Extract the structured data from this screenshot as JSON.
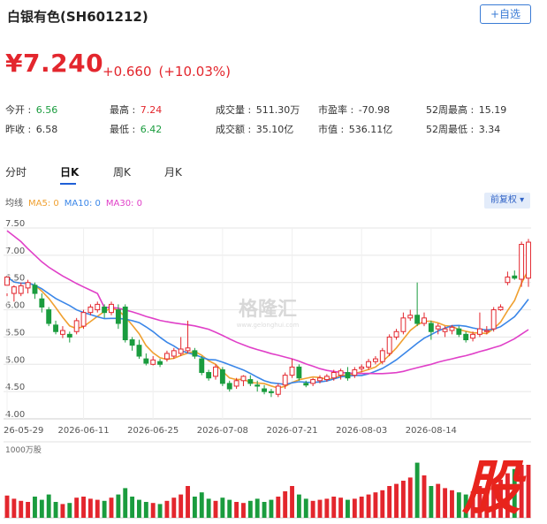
{
  "header": {
    "title": "白银有色(SH601212)",
    "favorite_label": "+自选"
  },
  "quote": {
    "price": "¥7.240",
    "change": "+0.660",
    "change_pct": "(+10.03%)"
  },
  "stats": [
    {
      "label": "今开",
      "value": "6.56",
      "color": "green"
    },
    {
      "label": "最高",
      "value": "7.24",
      "color": "red"
    },
    {
      "label": "成交量",
      "value": "511.30万",
      "color": "dark"
    },
    {
      "label": "市盈率",
      "value": "-70.98",
      "color": "dark"
    },
    {
      "label": "52周最高",
      "value": "15.19",
      "color": "dark"
    },
    {
      "label": "昨收",
      "value": "6.58",
      "color": "dark"
    },
    {
      "label": "最低",
      "value": "6.42",
      "color": "green"
    },
    {
      "label": "成交额",
      "value": "35.10亿",
      "color": "dark"
    },
    {
      "label": "市值",
      "value": "536.11亿",
      "color": "dark"
    },
    {
      "label": "52周最低",
      "value": "3.34",
      "color": "dark"
    }
  ],
  "tabs": [
    {
      "label": "分时",
      "active": false
    },
    {
      "label": "日K",
      "active": true
    },
    {
      "label": "周K",
      "active": false
    },
    {
      "label": "月K",
      "active": false
    }
  ],
  "ma_legend": {
    "prefix": "均线",
    "items": [
      {
        "label": "MA5: 0",
        "color": "#f0a030"
      },
      {
        "label": "MA10: 0",
        "color": "#3a86e8"
      },
      {
        "label": "MA30: 0",
        "color": "#e040c8"
      }
    ]
  },
  "adjust_label": "前复权",
  "volume_label": "1000万股",
  "watermark": "格隆汇",
  "watermark_sub": "www.gelonghui.com",
  "chart_data": {
    "type": "candlestick",
    "y_ticks": [
      "7.50",
      "7.00",
      "6.50",
      "6.00",
      "5.50",
      "5.00",
      "4.50",
      "4.00"
    ],
    "ylim": [
      4.0,
      7.5
    ],
    "x_tick_labels": [
      "26-05-29",
      "2026-06-11",
      "2026-06-25",
      "2026-07-08",
      "2026-07-21",
      "2026-08-03",
      "2026-08-14"
    ],
    "grid": true,
    "colors": {
      "up": "#e3262d",
      "down": "#1a9c3e",
      "ma5": "#f0a030",
      "ma10": "#3a86e8",
      "ma30": "#e040c8"
    },
    "candles": [
      [
        6.45,
        6.6,
        6.3,
        6.25
      ],
      [
        6.3,
        6.42,
        6.45,
        6.15
      ],
      [
        6.3,
        6.44,
        6.5,
        6.25
      ],
      [
        6.4,
        6.5,
        6.55,
        6.3
      ],
      [
        6.45,
        6.3,
        6.5,
        6.2
      ],
      [
        6.2,
        6.05,
        6.3,
        5.95
      ],
      [
        6.0,
        5.75,
        6.05,
        5.7
      ],
      [
        5.72,
        5.6,
        5.8,
        5.55
      ],
      [
        5.55,
        5.62,
        5.7,
        5.48
      ],
      [
        5.55,
        5.5,
        5.6,
        5.4
      ],
      [
        5.6,
        5.8,
        5.85,
        5.55
      ],
      [
        5.7,
        5.95,
        6.0,
        5.65
      ],
      [
        5.95,
        6.05,
        6.1,
        5.9
      ],
      [
        6.0,
        6.1,
        6.15,
        5.95
      ],
      [
        6.05,
        5.95,
        6.1,
        5.85
      ],
      [
        5.95,
        6.1,
        6.15,
        5.9
      ],
      [
        6.0,
        5.75,
        6.1,
        5.65
      ],
      [
        6.05,
        5.45,
        6.1,
        5.4
      ],
      [
        5.45,
        5.35,
        5.5,
        5.25
      ],
      [
        5.35,
        5.15,
        5.45,
        5.1
      ],
      [
        5.1,
        5.02,
        5.2,
        4.98
      ],
      [
        5.0,
        5.08,
        5.15,
        4.98
      ],
      [
        5.05,
        5.0,
        5.1,
        4.95
      ],
      [
        5.1,
        5.2,
        5.25,
        5.05
      ],
      [
        5.15,
        5.25,
        5.3,
        5.1
      ],
      [
        5.2,
        5.28,
        5.5,
        5.15
      ],
      [
        5.25,
        5.3,
        5.8,
        5.2
      ],
      [
        5.25,
        5.15,
        5.3,
        5.1
      ],
      [
        5.1,
        4.85,
        5.15,
        4.8
      ],
      [
        4.85,
        4.75,
        4.9,
        4.7
      ],
      [
        4.78,
        4.95,
        5.0,
        4.72
      ],
      [
        4.9,
        4.65,
        4.95,
        4.6
      ],
      [
        4.65,
        4.55,
        4.7,
        4.5
      ],
      [
        4.6,
        4.7,
        4.75,
        4.55
      ],
      [
        4.7,
        4.78,
        4.8,
        4.6
      ],
      [
        4.72,
        4.65,
        4.8,
        4.6
      ],
      [
        4.62,
        4.6,
        4.7,
        4.5
      ],
      [
        4.55,
        4.5,
        4.62,
        4.45
      ],
      [
        4.5,
        4.48,
        4.55,
        4.4
      ],
      [
        4.45,
        4.6,
        4.65,
        4.4
      ],
      [
        4.62,
        4.8,
        4.85,
        4.55
      ],
      [
        4.8,
        4.95,
        5.1,
        4.75
      ],
      [
        4.95,
        4.75,
        5.0,
        4.7
      ],
      [
        4.65,
        4.62,
        4.7,
        4.58
      ],
      [
        4.65,
        4.72,
        4.75,
        4.6
      ],
      [
        4.7,
        4.75,
        4.8,
        4.65
      ],
      [
        4.72,
        4.78,
        4.82,
        4.68
      ],
      [
        4.75,
        4.85,
        4.9,
        4.7
      ],
      [
        4.8,
        4.88,
        4.92,
        4.72
      ],
      [
        4.85,
        4.75,
        4.95,
        4.7
      ],
      [
        4.8,
        4.9,
        4.95,
        4.75
      ],
      [
        4.92,
        4.95,
        5.0,
        4.85
      ],
      [
        4.95,
        5.05,
        5.1,
        4.9
      ],
      [
        5.05,
        5.1,
        5.15,
        5.0
      ],
      [
        5.05,
        5.25,
        5.3,
        5.0
      ],
      [
        5.2,
        5.5,
        5.55,
        5.15
      ],
      [
        5.5,
        5.6,
        5.65,
        5.45
      ],
      [
        5.6,
        5.85,
        5.95,
        5.55
      ],
      [
        5.85,
        5.9,
        6.0,
        5.8
      ],
      [
        5.9,
        5.75,
        6.5,
        5.7
      ],
      [
        5.75,
        5.85,
        5.95,
        5.7
      ],
      [
        5.75,
        5.6,
        5.8,
        5.45
      ],
      [
        5.65,
        5.7,
        5.75,
        5.55
      ],
      [
        5.6,
        5.65,
        5.7,
        5.5
      ],
      [
        5.62,
        5.68,
        5.72,
        5.55
      ],
      [
        5.65,
        5.55,
        5.7,
        5.5
      ],
      [
        5.55,
        5.45,
        5.6,
        5.4
      ],
      [
        5.48,
        5.55,
        5.6,
        5.42
      ],
      [
        5.55,
        5.65,
        5.95,
        5.5
      ],
      [
        5.6,
        5.62,
        5.7,
        5.55
      ],
      [
        5.65,
        6.0,
        6.05,
        5.6
      ],
      [
        6.0,
        6.05,
        6.1,
        5.98
      ],
      [
        6.5,
        6.6,
        6.7,
        6.45
      ],
      [
        6.62,
        6.58,
        6.72,
        6.55
      ],
      [
        6.56,
        7.2,
        7.25,
        6.42
      ],
      [
        6.58,
        7.24,
        7.3,
        6.42
      ]
    ],
    "volumes": [
      2.1,
      1.8,
      1.6,
      1.5,
      2.0,
      1.7,
      2.2,
      1.5,
      1.3,
      1.4,
      1.9,
      2.0,
      1.8,
      1.7,
      1.6,
      1.9,
      2.2,
      2.8,
      2.0,
      1.7,
      1.5,
      1.4,
      1.3,
      1.6,
      1.9,
      2.2,
      3.0,
      2.0,
      2.4,
      1.8,
      1.6,
      1.9,
      1.7,
      1.5,
      1.4,
      1.6,
      1.8,
      1.5,
      1.7,
      2.0,
      2.5,
      3.0,
      2.2,
      1.8,
      1.6,
      1.7,
      1.8,
      2.0,
      1.9,
      1.7,
      1.8,
      2.0,
      2.2,
      2.4,
      2.6,
      3.0,
      3.2,
      3.5,
      3.8,
      5.2,
      4.0,
      3.0,
      3.2,
      2.8,
      2.6,
      2.4,
      2.2,
      2.5,
      3.0,
      2.6,
      3.4,
      3.6,
      4.2,
      4.6,
      5.0,
      5.0
    ],
    "vol_max": 5.5
  }
}
